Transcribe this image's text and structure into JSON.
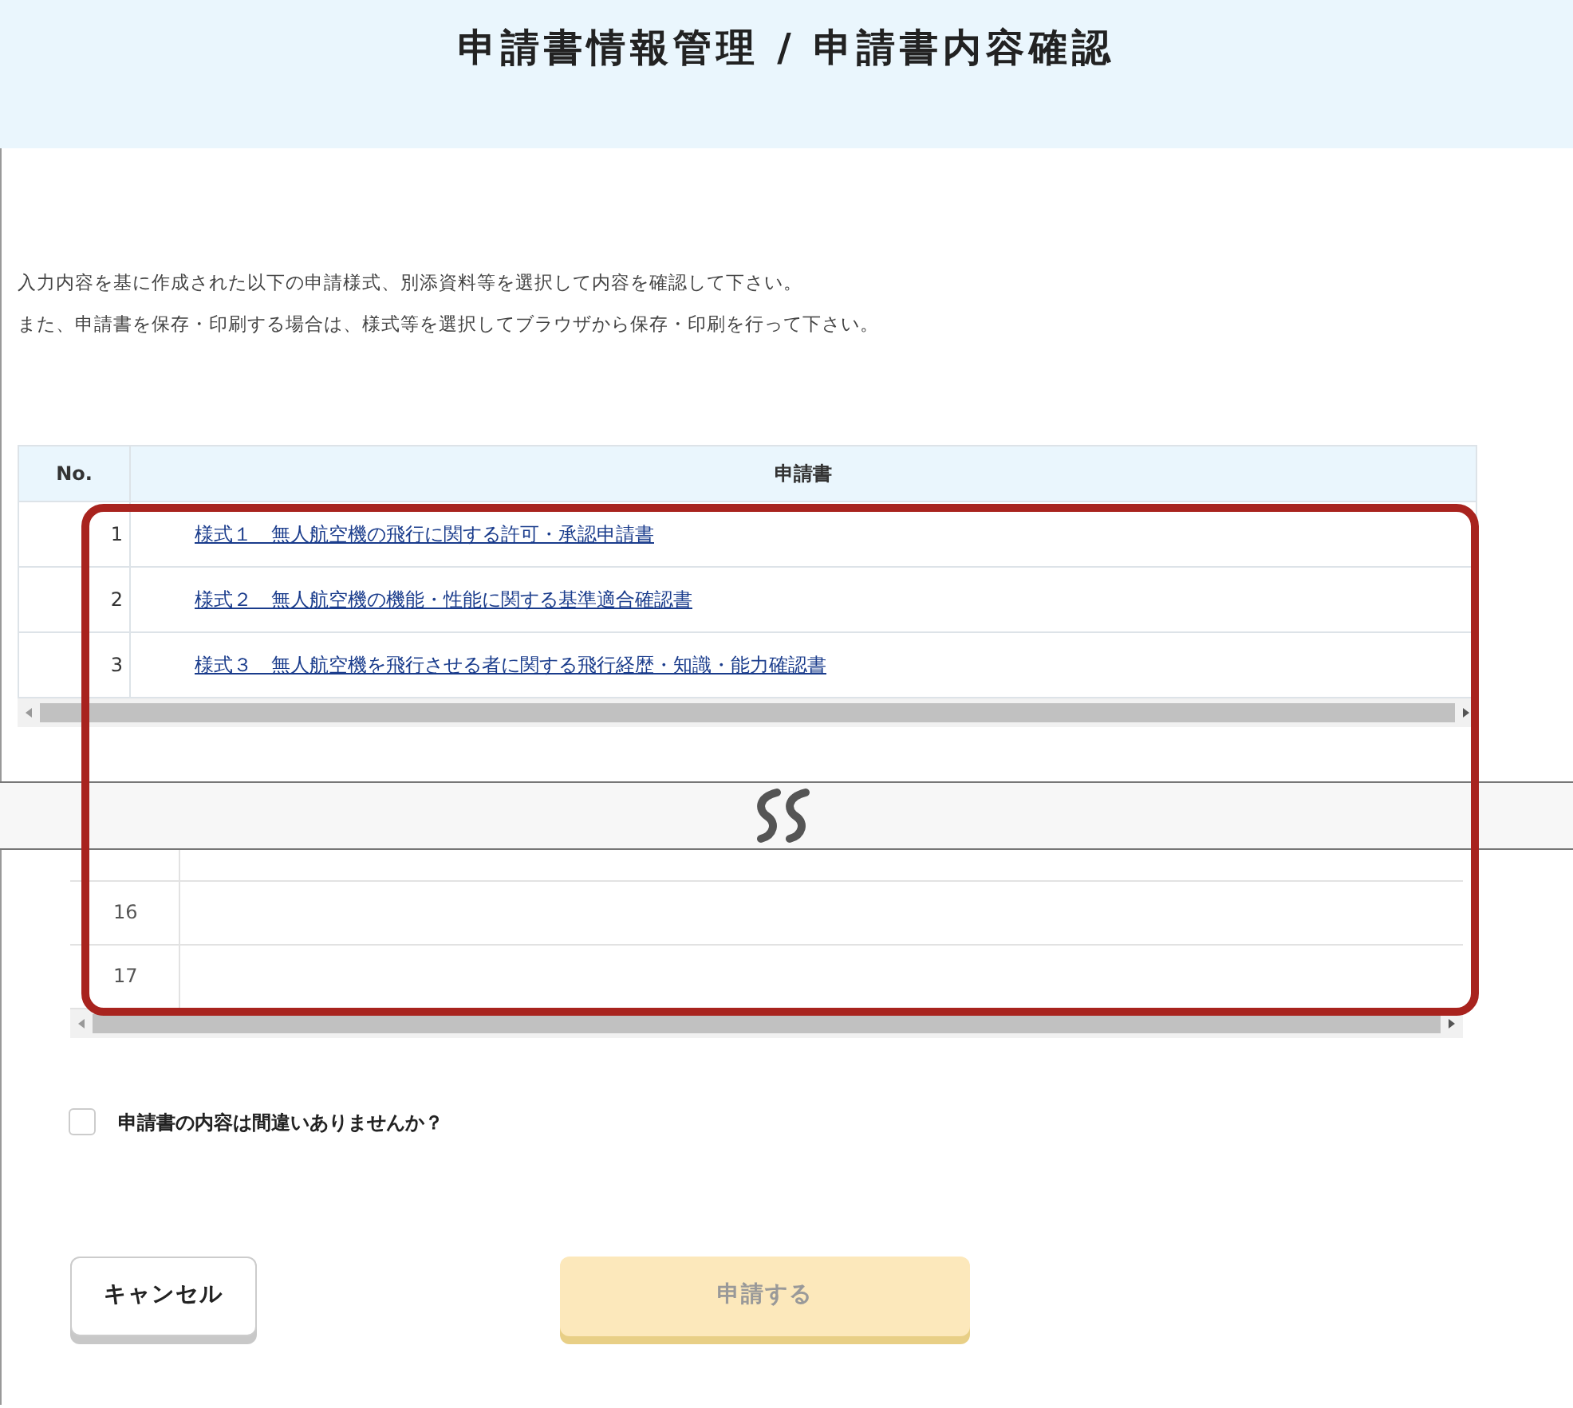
{
  "header": {
    "title": "申請書情報管理 / 申請書内容確認"
  },
  "instructions": [
    "入力内容を基に作成された以下の申請様式、別添資料等を選択して内容を確認して下さい。",
    "また、申請書を保存・印刷する場合は、様式等を選択してブラウザから保存・印刷を行って下さい。"
  ],
  "table": {
    "columns": [
      "No.",
      "申請書"
    ],
    "rows": [
      {
        "no": "1",
        "form": "様式１　無人航空機の飛行に関する許可・承認申請書"
      },
      {
        "no": "2",
        "form": "様式２　無人航空機の機能・性能に関する基準適合確認書"
      },
      {
        "no": "3",
        "form": "様式３　無人航空機を飛行させる者に関する飛行経歴・知識・能力確認書"
      }
    ]
  },
  "table_continued": {
    "rows": [
      {
        "no": "16"
      },
      {
        "no": "17"
      }
    ]
  },
  "confirm": {
    "label": "申請書の内容は間違いありませんか？",
    "checked": false
  },
  "buttons": [
    {
      "label": "キャンセル",
      "kind": "secondary",
      "disabled": false
    },
    {
      "label": "申請する",
      "kind": "primary",
      "disabled": true
    }
  ]
}
